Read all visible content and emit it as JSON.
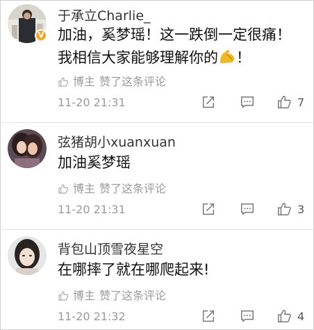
{
  "comments": [
    {
      "username": "于承立Charlie_",
      "verified": true,
      "lines": [
        "加油，奚梦瑶！这一跌倒一定很痛！",
        "我相信大家能够理解你的"
      ],
      "line_suffix": "！",
      "like_label_author": "博主",
      "like_label_text": "赞了这条评论",
      "timestamp": "11-20 21:31",
      "like_count": "7"
    },
    {
      "username": "弦猪胡小xuanxuan",
      "verified": false,
      "lines": [
        "加油奚梦瑶"
      ],
      "like_label_author": "博主",
      "like_label_text": "赞了这条评论",
      "timestamp": "11-20 21:31",
      "like_count": "3"
    },
    {
      "username": "背包山顶雪夜星空",
      "verified": false,
      "lines": [
        "在哪摔了就在哪爬起来!"
      ],
      "like_label_author": "博主",
      "like_label_text": "赞了这条评论",
      "timestamp": "11-20 21:32",
      "like_count": "4"
    }
  ],
  "colors": {
    "text_main": "#111111",
    "text_muted": "#9a9a9a",
    "badge": "#f5a623",
    "emoji": "#f2b824"
  }
}
